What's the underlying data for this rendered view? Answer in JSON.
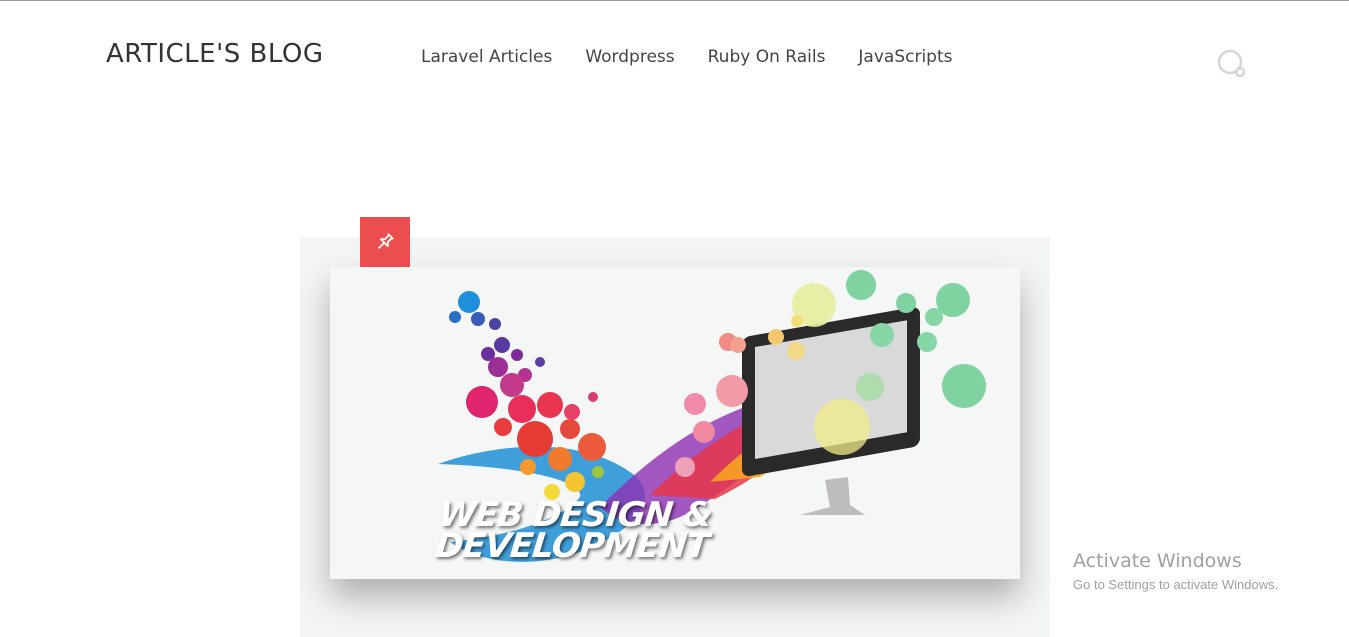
{
  "header": {
    "site_title": "ARTICLE'S BLOG",
    "nav": [
      {
        "label": "Laravel Articles"
      },
      {
        "label": "Wordpress"
      },
      {
        "label": "Ruby On Rails"
      },
      {
        "label": "JavaScripts"
      }
    ],
    "search_icon": "search-icon"
  },
  "post": {
    "pin_icon": "pin-icon",
    "accent_color": "#ec4d4f",
    "featured_image_text": [
      "WEB DESIGN &",
      "DEVELOPMENT"
    ]
  },
  "watermark": {
    "title": "Activate Windows",
    "subtitle": "Go to Settings to activate Windows."
  }
}
